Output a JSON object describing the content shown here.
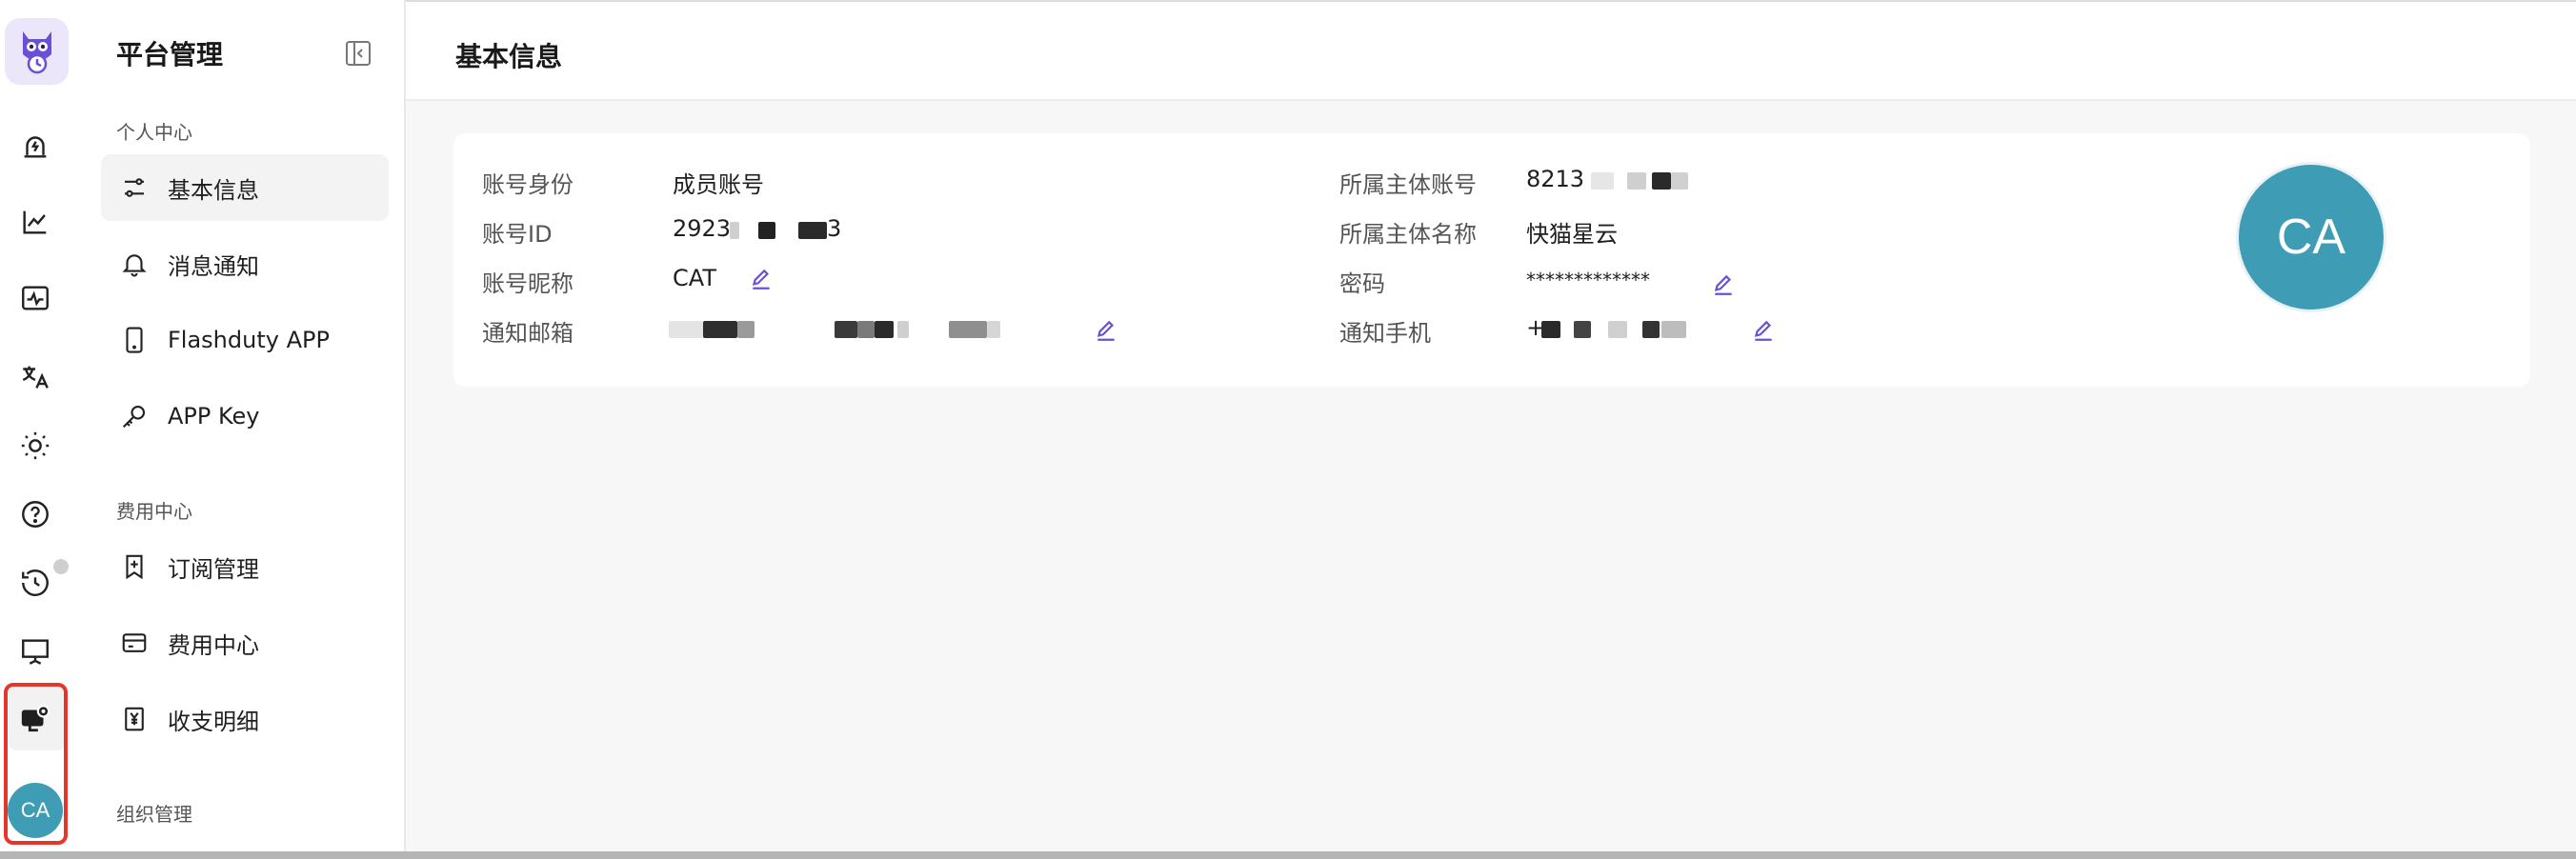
{
  "rail": {
    "icons": [
      "owl-logo-icon",
      "incident-alarm-icon",
      "analytics-chart-icon",
      "monitor-pulse-icon",
      "translate-icon",
      "theme-sun-icon",
      "help-icon",
      "history-icon",
      "presentation-icon",
      "account-settings-icon"
    ],
    "avatar_text": "CA"
  },
  "sidebar": {
    "title": "平台管理",
    "sections": [
      {
        "label": "个人中心",
        "items": [
          "基本信息",
          "消息通知",
          "Flashduty APP",
          "APP Key"
        ]
      },
      {
        "label": "费用中心",
        "items": [
          "订阅管理",
          "费用中心",
          "收支明细"
        ]
      },
      {
        "label": "组织管理",
        "items": []
      }
    ]
  },
  "header": {
    "title": "基本信息"
  },
  "profile": {
    "left": [
      {
        "label": "账号身份",
        "value": "成员账号"
      },
      {
        "label": "账号ID",
        "value": "2923"
      },
      {
        "label": "账号昵称",
        "value": "CAT"
      },
      {
        "label": "通知邮箱",
        "value": ""
      }
    ],
    "right": [
      {
        "label": "所属主体账号",
        "value": "8213"
      },
      {
        "label": "所属主体名称",
        "value": "快猫星云"
      },
      {
        "label": "密码",
        "value": "*************"
      },
      {
        "label": "通知手机",
        "value": "+"
      }
    ],
    "id_suffix": "3",
    "avatar_text": "CA"
  },
  "colors": {
    "accent": "#6b4fd8",
    "avatar": "#3e9db5",
    "highlight": "#e5362b"
  }
}
